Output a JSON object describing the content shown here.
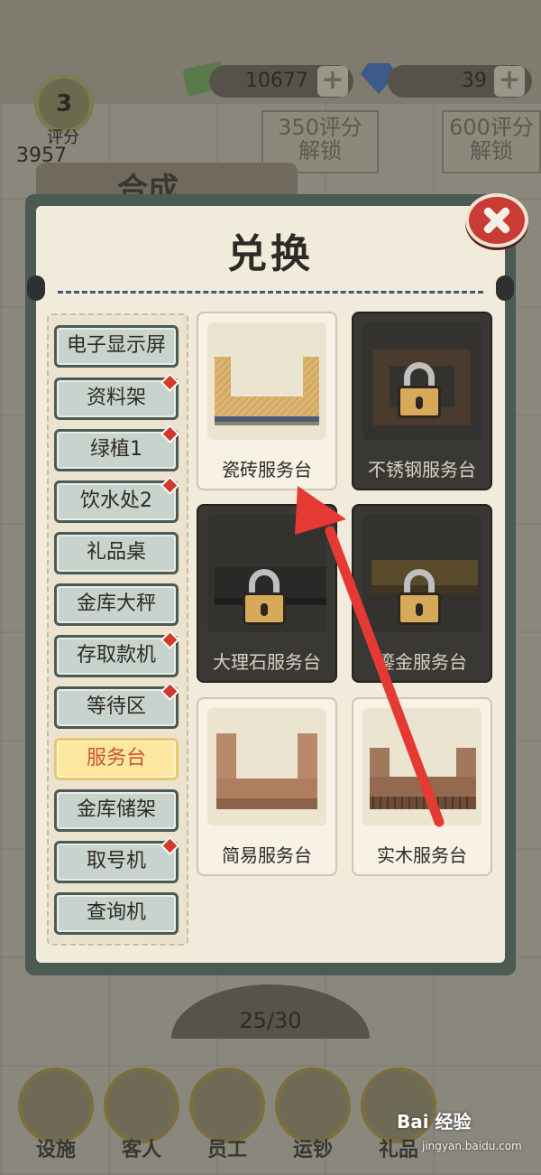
{
  "background": {
    "money": "10677",
    "gems": "39",
    "rating_level": "3",
    "rating_label": "评分",
    "rating_value": "3957",
    "unlock_350": [
      "350评分",
      "解锁"
    ],
    "unlock_600": [
      "600评分",
      "解锁"
    ],
    "tab_label": "合成",
    "counter": "25/30",
    "bottom_nav": [
      "设施",
      "客人",
      "员工",
      "运钞",
      "礼品"
    ]
  },
  "dialog": {
    "title": "兑换",
    "close_icon": "close-icon"
  },
  "categories": [
    {
      "label": "电子显示屏",
      "dot": false,
      "selected": false
    },
    {
      "label": "资料架",
      "dot": true,
      "selected": false
    },
    {
      "label": "绿植1",
      "dot": true,
      "selected": false
    },
    {
      "label": "饮水处2",
      "dot": true,
      "selected": false
    },
    {
      "label": "礼品桌",
      "dot": false,
      "selected": false
    },
    {
      "label": "金库大秤",
      "dot": false,
      "selected": false
    },
    {
      "label": "存取款机",
      "dot": true,
      "selected": false
    },
    {
      "label": "等待区",
      "dot": true,
      "selected": false
    },
    {
      "label": "服务台",
      "dot": false,
      "selected": true
    },
    {
      "label": "金库储架",
      "dot": false,
      "selected": false
    },
    {
      "label": "取号机",
      "dot": true,
      "selected": false
    },
    {
      "label": "查询机",
      "dot": false,
      "selected": false
    }
  ],
  "items": [
    {
      "label": "瓷砖服务台",
      "locked": false
    },
    {
      "label": "不锈钢服务台",
      "locked": true
    },
    {
      "label": "大理石服务台",
      "locked": true
    },
    {
      "label": "鎏金服务台",
      "locked": true
    },
    {
      "label": "简易服务台",
      "locked": false
    },
    {
      "label": "实木服务台",
      "locked": false
    }
  ],
  "watermark": {
    "text": "Bai 经验",
    "url": "jingyan.baidu.com"
  },
  "colors": {
    "accent_red": "#d23b2b",
    "arrow": "#e53a33",
    "selected_bg": "#fce6a0"
  }
}
